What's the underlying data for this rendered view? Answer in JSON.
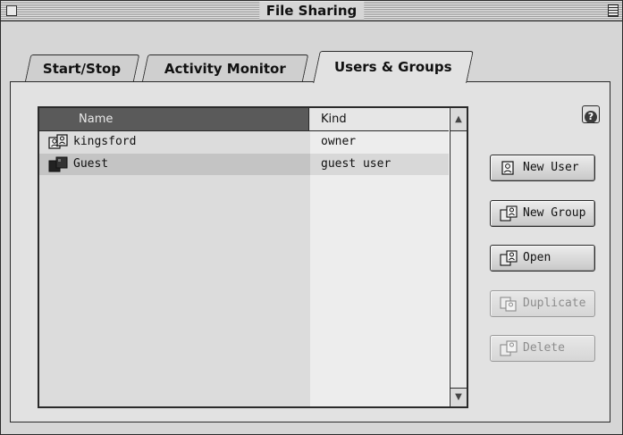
{
  "window": {
    "title": "File Sharing"
  },
  "tabs": [
    {
      "label": "Start/Stop",
      "active": false
    },
    {
      "label": "Activity Monitor",
      "active": false
    },
    {
      "label": "Users & Groups",
      "active": true
    }
  ],
  "list": {
    "columns": [
      "Name",
      "Kind"
    ],
    "rows": [
      {
        "name": "kingsford",
        "kind": "owner",
        "icon": "owner-user-icon",
        "selected": false
      },
      {
        "name": "Guest",
        "kind": "guest user",
        "icon": "guest-user-icon",
        "selected": true
      }
    ]
  },
  "help": {
    "icon": "help-icon"
  },
  "buttons": {
    "new_user": {
      "label": "New User",
      "icon": "new-user-icon",
      "enabled": true
    },
    "new_group": {
      "label": "New Group",
      "icon": "new-group-icon",
      "enabled": true
    },
    "open": {
      "label": "Open",
      "icon": "open-icon",
      "enabled": true
    },
    "duplicate": {
      "label": "Duplicate",
      "icon": "duplicate-icon",
      "enabled": false
    },
    "delete": {
      "label": "Delete",
      "icon": "delete-icon",
      "enabled": false
    }
  }
}
